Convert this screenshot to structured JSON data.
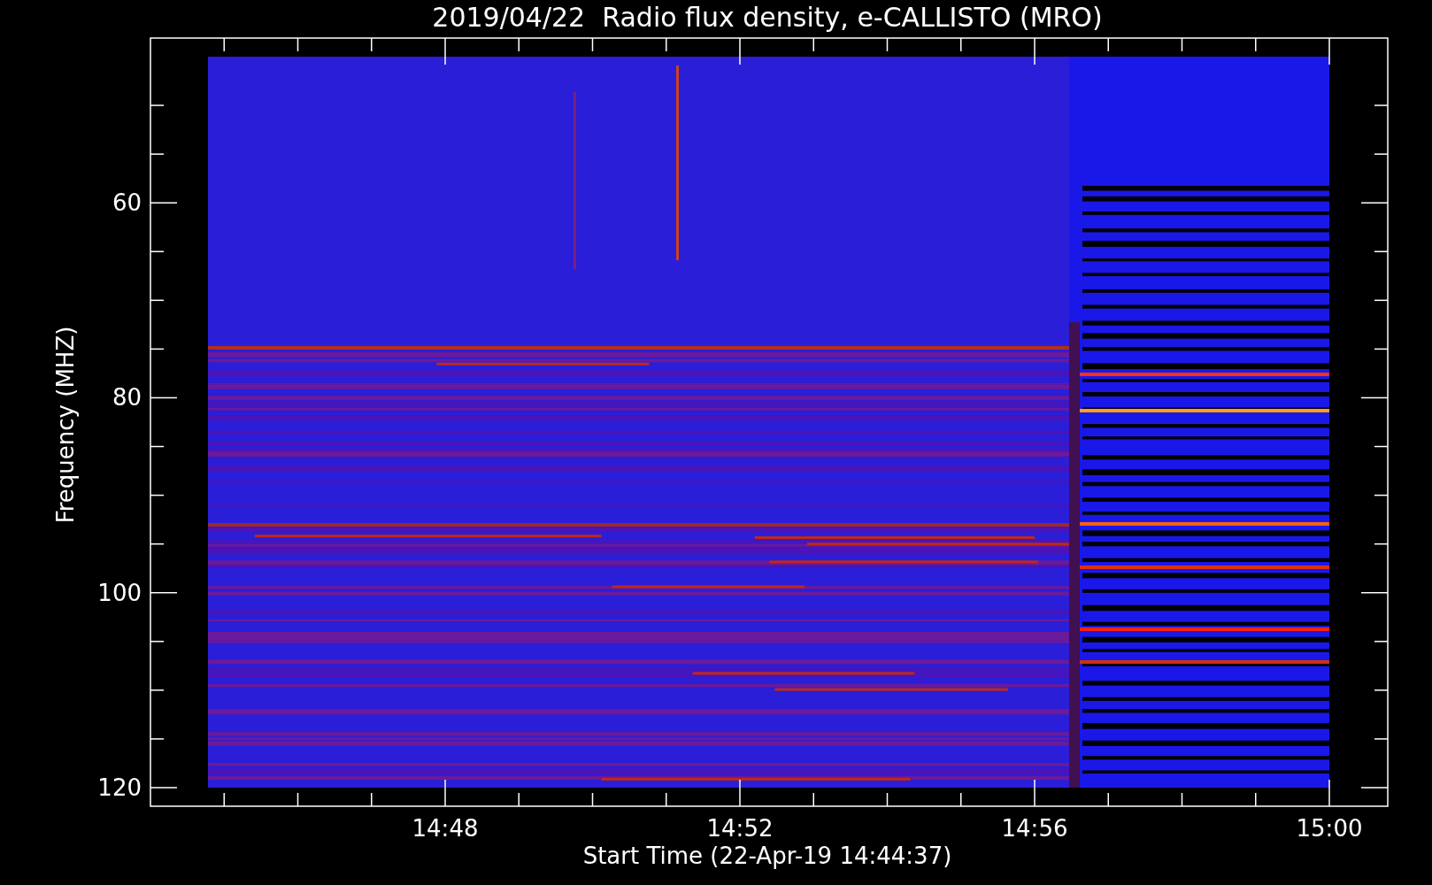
{
  "title": "2019/04/22  Radio flux density, e-CALLISTO (MRO)",
  "y_axis": {
    "label": "Frequency (MHZ)",
    "ticks": [
      "60",
      "80",
      "100",
      "120"
    ]
  },
  "x_axis": {
    "label": "Start Time (22-Apr-19 14:44:37)",
    "ticks": [
      "14:48",
      "14:52",
      "14:56",
      "15:00"
    ]
  }
}
